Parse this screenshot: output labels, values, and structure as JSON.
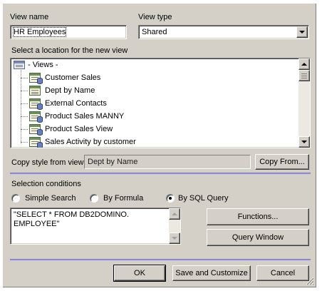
{
  "view_name": {
    "label": "View name",
    "value": "HR Employees"
  },
  "view_type": {
    "label": "View type",
    "value": "Shared"
  },
  "location": {
    "label": "Select a location for the new view",
    "root": "- Views -",
    "items": [
      {
        "label": "Customer Sales",
        "icon": "db-view-icon"
      },
      {
        "label": "Dept by Name",
        "icon": "view-icon"
      },
      {
        "label": "External Contacts",
        "icon": "db-view-icon"
      },
      {
        "label": "Product Sales MANNY",
        "icon": "db-view-icon"
      },
      {
        "label": "Product Sales View",
        "icon": "db-view-icon"
      },
      {
        "label": "Sales Activity by customer",
        "icon": "db-view-icon"
      }
    ]
  },
  "copy_style": {
    "label": "Copy style from view",
    "value": "Dept by Name",
    "button": "Copy From..."
  },
  "selection": {
    "label": "Selection conditions",
    "options": [
      {
        "label": "Simple Search",
        "selected": false
      },
      {
        "label": "By Formula",
        "selected": false
      },
      {
        "label": "By SQL Query",
        "selected": true
      }
    ],
    "query_text": "\"SELECT * FROM DB2DOMINO.\nEMPLOYEE\"",
    "functions_button": "Functions...",
    "query_window_button": "Query Window"
  },
  "footer": {
    "ok": "OK",
    "save_customize": "Save and Customize",
    "cancel": "Cancel"
  },
  "colors": {
    "dialog_bg": "#d4d0c8",
    "separator": "#9a9ad0"
  }
}
